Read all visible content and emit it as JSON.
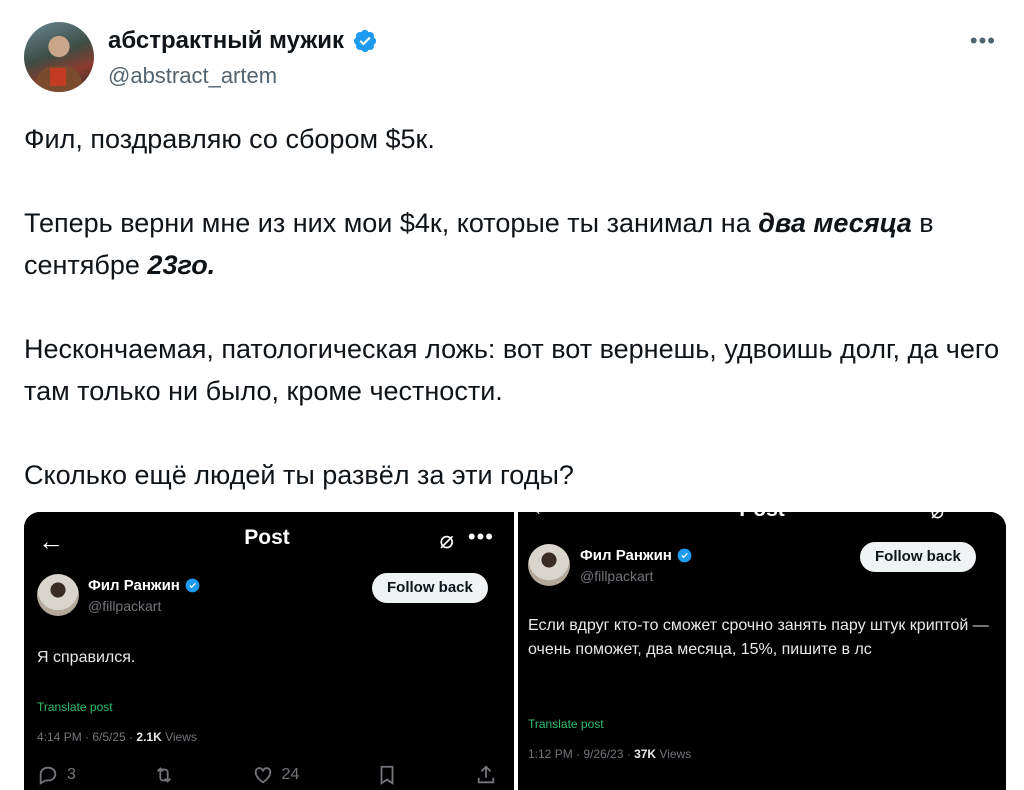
{
  "tweet": {
    "display_name": "абстрактный мужик",
    "handle": "@abstract_artem",
    "more_label": "•••",
    "paragraphs": {
      "p1": "Фил, поздравляю со сбором $5к.",
      "p2_a": "Теперь верни мне из них мои $4к, которые ты занимал на ",
      "p2_b": "два месяца",
      "p2_c": " в сентябре ",
      "p2_d": "23го.",
      "p3": "Нескончаемая, патологическая ложь: вот вот вернешь, удвоишь долг, да чего там только ни было, кроме честности.",
      "p4": "Сколько ещё людей ты развёл за эти годы?"
    }
  },
  "colors": {
    "verified": "#1d9bf0",
    "text": "#0f1419",
    "muted": "#536471",
    "dark_bg": "#000000"
  },
  "screenshot_left": {
    "back": "←",
    "title": "Post",
    "grok": "⌀",
    "dots": "•••",
    "name": "Фил Ранжин",
    "handle": "@fillpackart",
    "follow": "Follow back",
    "text": "Я справился.",
    "translate": "Translate post",
    "meta_time": "4:14 PM · 6/5/25 · ",
    "meta_views": "2.1K",
    "meta_views_label": " Views",
    "replies": "3",
    "likes": "24"
  },
  "screenshot_right": {
    "back": "←",
    "title": "Post",
    "grok": "⌀",
    "name": "Фил Ранжин",
    "handle": "@fillpackart",
    "follow": "Follow back",
    "text": "Если вдруг кто-то сможет срочно занять пару штук криптой — очень поможет, два месяца, 15%, пишите в лс",
    "translate": "Translate post",
    "meta_time": "1:12 PM · 9/26/23 · ",
    "meta_views": "37K",
    "meta_views_label": " Views"
  }
}
